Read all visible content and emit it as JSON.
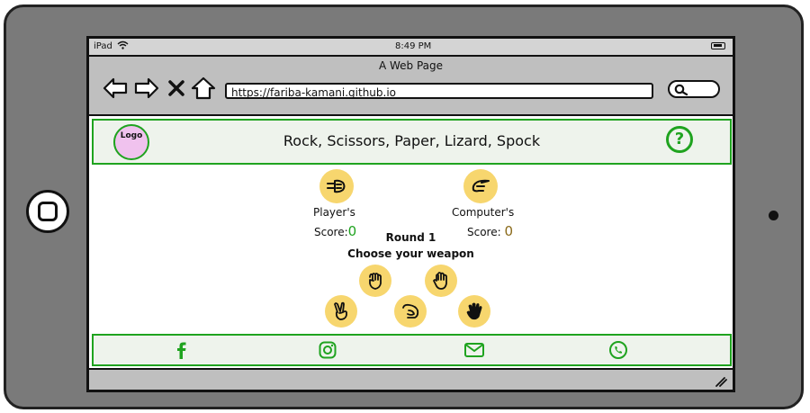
{
  "status": {
    "device": "iPad",
    "time": "8:49 PM"
  },
  "browser": {
    "title": "A Web Page",
    "url": "https://fariba-kamani.github.io"
  },
  "header": {
    "logo": "Logo",
    "title": "Rock, Scissors, Paper, Lizard, Spock",
    "help_symbol": "?"
  },
  "game": {
    "player_label": "Player's",
    "computer_label": "Computer's",
    "score_label": "Score:",
    "player_score": "0",
    "computer_score": "0",
    "round": "Round 1",
    "prompt": "Choose your weapon"
  },
  "weapons": [
    "rock",
    "paper",
    "scissors",
    "lizard",
    "spock"
  ],
  "colors": {
    "accent_green": "#1fa31f",
    "circle_yellow": "#f7d66e",
    "header_bg": "#eef3ec",
    "logo_pink": "#f0c2ee"
  }
}
